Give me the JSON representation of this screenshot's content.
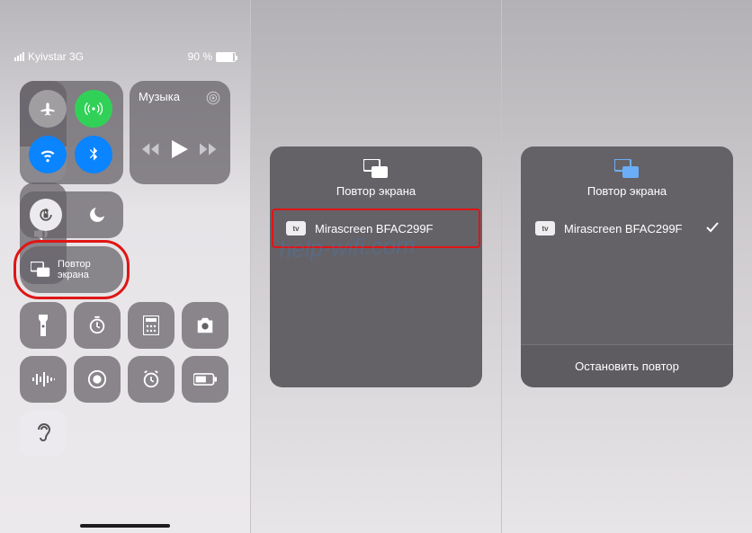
{
  "panel1": {
    "carrier": "Kyivstar 3G",
    "battery_pct": "90 %",
    "music_label": "Музыка",
    "mirror_line1": "Повтор",
    "mirror_line2": "экрана"
  },
  "panel2": {
    "title": "Повтор экрана",
    "device": "Mirascreen BFAC299F"
  },
  "panel3": {
    "title": "Повтор экрана",
    "device": "Mirascreen BFAC299F",
    "stop": "Остановить повтор"
  },
  "watermark": "help-wifi.com"
}
